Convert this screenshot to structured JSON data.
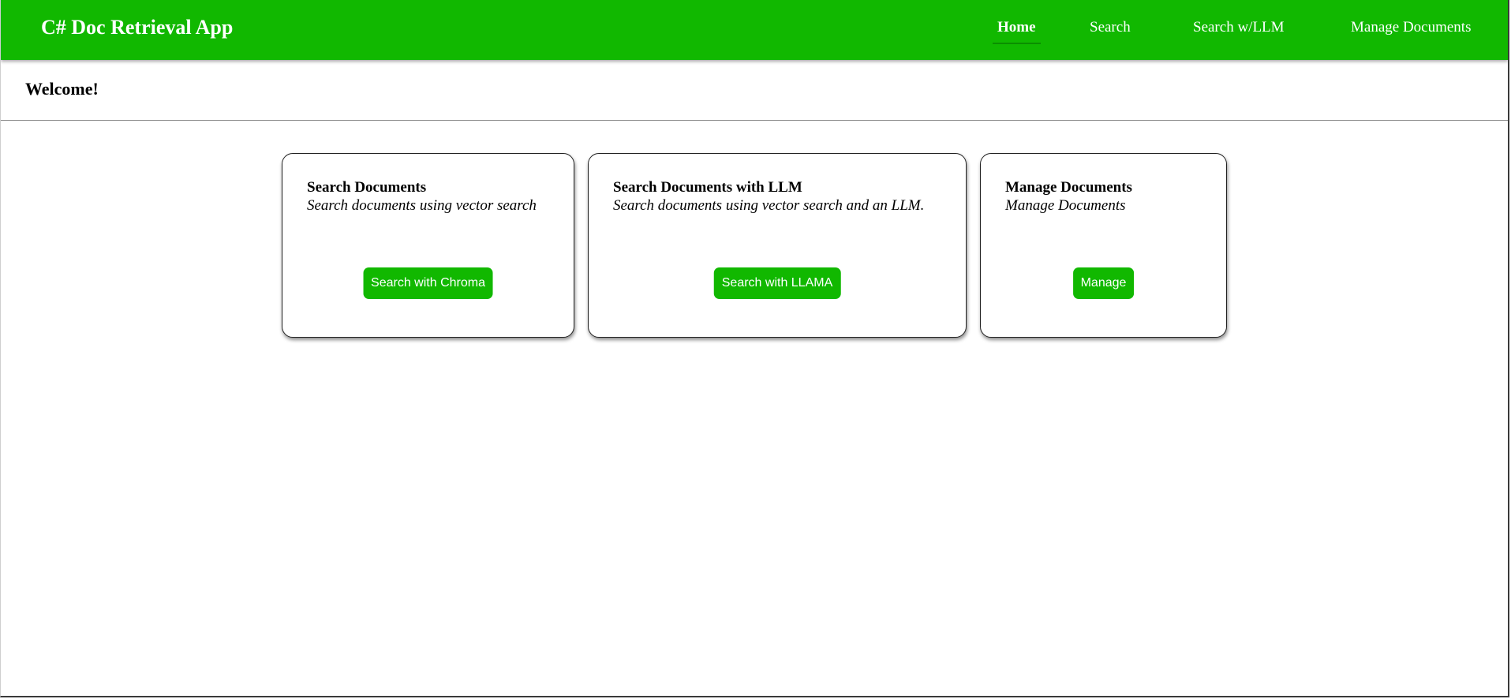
{
  "header": {
    "title": "C# Doc Retrieval App",
    "nav": {
      "home": "Home",
      "search": "Search",
      "search_llm": "Search w/LLM",
      "manage": "Manage Documents"
    },
    "active_nav": "home"
  },
  "welcome": {
    "title": "Welcome!"
  },
  "cards": [
    {
      "title": "Search Documents",
      "description": "Search documents using vector search",
      "button_label": "Search with Chroma"
    },
    {
      "title": "Search Documents with LLM",
      "description": "Search documents using vector search and an LLM.",
      "button_label": "Search with LLAMA"
    },
    {
      "title": "Manage Documents",
      "description": "Manage Documents",
      "button_label": "Manage"
    }
  ],
  "colors": {
    "accent": "#11b800",
    "text": "#000000",
    "background": "#ffffff"
  }
}
